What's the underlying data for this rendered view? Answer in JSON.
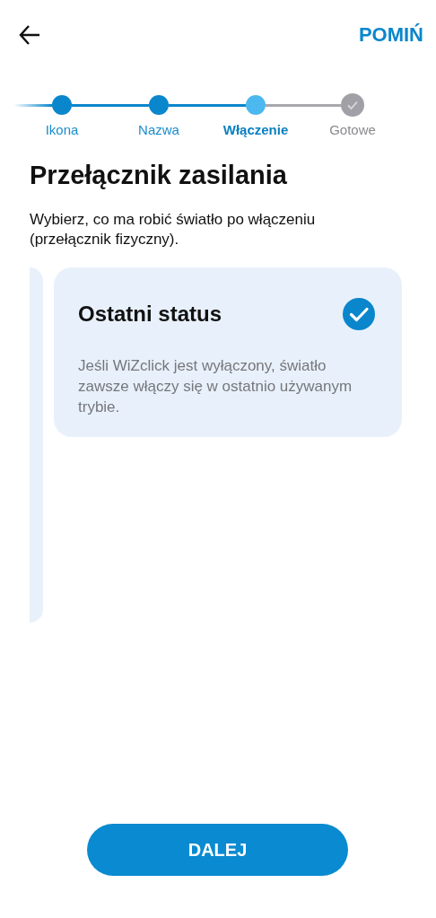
{
  "header": {
    "skip": "POMIŃ"
  },
  "steps": [
    {
      "label": "Ikona",
      "completed": true,
      "selected": false
    },
    {
      "label": "Nazwa",
      "completed": true,
      "selected": false
    },
    {
      "label": "Włączenie",
      "completed": false,
      "selected": true
    },
    {
      "label": "Gotowe",
      "completed": false,
      "selected": false
    }
  ],
  "title": "Przełącznik zasilania",
  "description": "Wybierz, co ma robić światło po włączeniu (przełącznik fizyczny).",
  "options": [
    {
      "title": "Ostatni status",
      "text": "Jeśli WiZclick jest wyłączony, światło zawsze włączy się w ostatnio używanym trybie.",
      "selected": true
    }
  ],
  "next_button": "DALEJ"
}
